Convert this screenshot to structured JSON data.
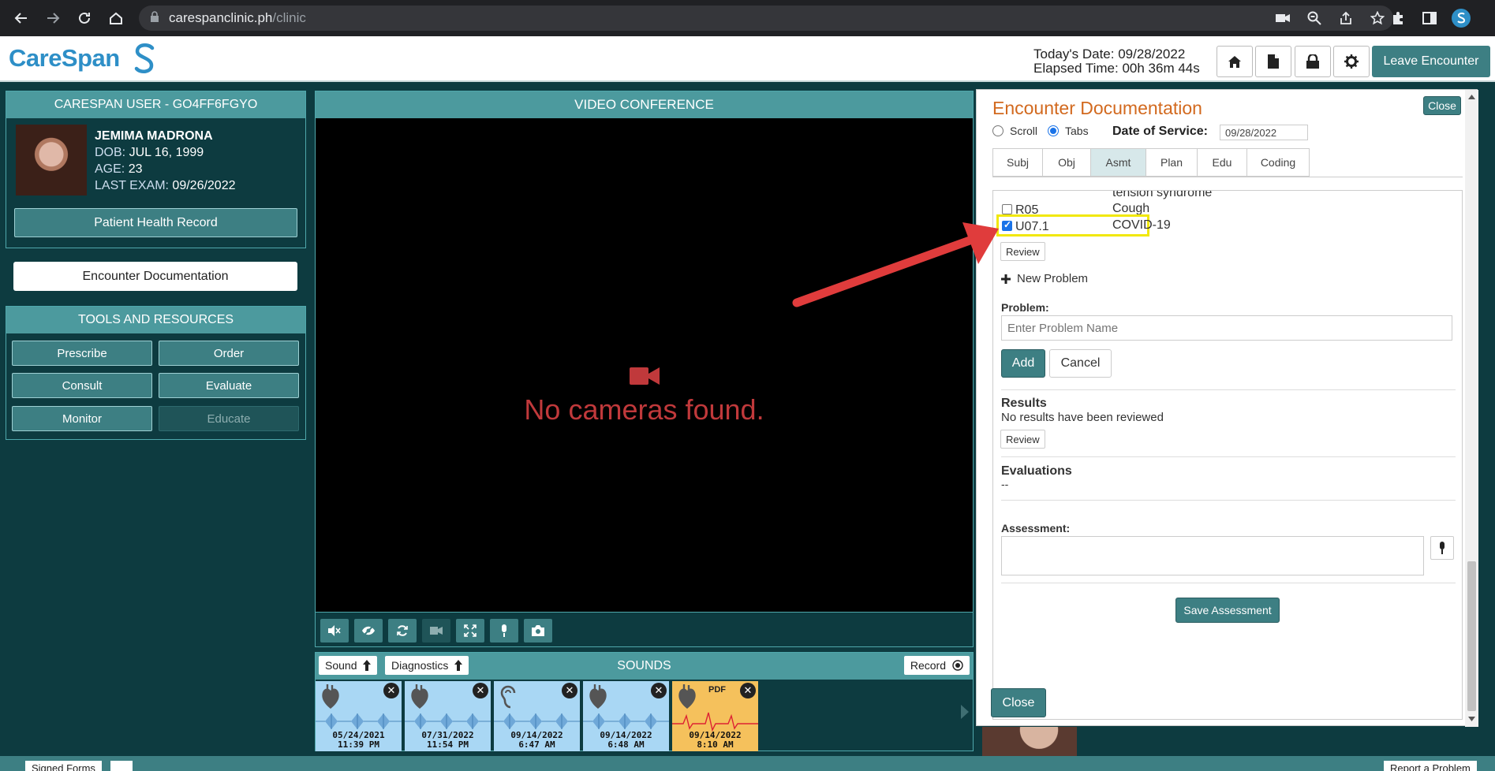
{
  "browser": {
    "url_host": "carespanclinic.ph",
    "url_path": "/clinic"
  },
  "header": {
    "logo_text": "CareSpan",
    "today_label": "Today's Date: 09/28/2022",
    "elapsed_label": "Elapsed Time: 00h 36m 44s",
    "leave_label": "Leave Encounter"
  },
  "user_panel": {
    "title": "CARESPAN USER - GO4FF6FGYO",
    "patient_name": "JEMIMA MADRONA",
    "dob_label": "DOB:",
    "dob": "JUL 16, 1999",
    "age_label": "AGE:",
    "age": "23",
    "last_exam_label": "LAST EXAM:",
    "last_exam": "09/26/2022",
    "phr_button": "Patient Health Record"
  },
  "encounter_doc_button": "Encounter Documentation",
  "tools": {
    "title": "TOOLS AND RESOURCES",
    "buttons": [
      "Prescribe",
      "Order",
      "Consult",
      "Evaluate",
      "Monitor",
      "Educate"
    ]
  },
  "video": {
    "title": "VIDEO CONFERENCE",
    "message": "No cameras found."
  },
  "sounds": {
    "title": "SOUNDS",
    "sound_select": "Sound",
    "diagnostics_select": "Diagnostics",
    "record_label": "Record",
    "items": [
      {
        "date": "05/24/2021",
        "time": "11:39 PM",
        "type": "heart"
      },
      {
        "date": "07/31/2022",
        "time": "11:54 PM",
        "type": "heart"
      },
      {
        "date": "09/14/2022",
        "time": "6:47 AM",
        "type": "ear"
      },
      {
        "date": "09/14/2022",
        "time": "6:48 AM",
        "type": "heart"
      },
      {
        "date": "09/14/2022",
        "time": "8:10 AM",
        "type": "pdf",
        "label": "PDF"
      }
    ]
  },
  "bottom": {
    "left_tag": "Signed Forms",
    "right_tag": "Report a Problem"
  },
  "modal": {
    "title": "Encounter Documentation",
    "close_top": "Close",
    "scroll_label": "Scroll",
    "tabs_label": "Tabs",
    "dos_label": "Date of Service:",
    "dos_value": "09/28/2022",
    "tabs": [
      "Subj",
      "Obj",
      "Asmt",
      "Plan",
      "Edu",
      "Coding"
    ],
    "active_tab": "Asmt",
    "problems": [
      {
        "code": "",
        "desc": "tension syndrome",
        "checked": false
      },
      {
        "code": "R05",
        "desc": "Cough",
        "checked": false
      },
      {
        "code": "U07.1",
        "desc": "COVID-19",
        "checked": true
      }
    ],
    "review_label": "Review",
    "new_problem_label": "New Problem",
    "problem_field_label": "Problem:",
    "problem_placeholder": "Enter Problem Name",
    "add_label": "Add",
    "cancel_label": "Cancel",
    "results_title": "Results",
    "results_text": "No results have been reviewed",
    "evaluations_title": "Evaluations",
    "evaluations_text": "--",
    "assessment_label": "Assessment:",
    "save_assessment": "Save Assessment",
    "close_bottom": "Close"
  },
  "colors": {
    "teal": "#3d7f83",
    "panel_header": "#4c9a9e",
    "background": "#0d3b40",
    "title_orange": "#d2691e",
    "highlight": "#f1e80b",
    "arrow": "#e03c3c",
    "camera_red": "#c0393b"
  }
}
